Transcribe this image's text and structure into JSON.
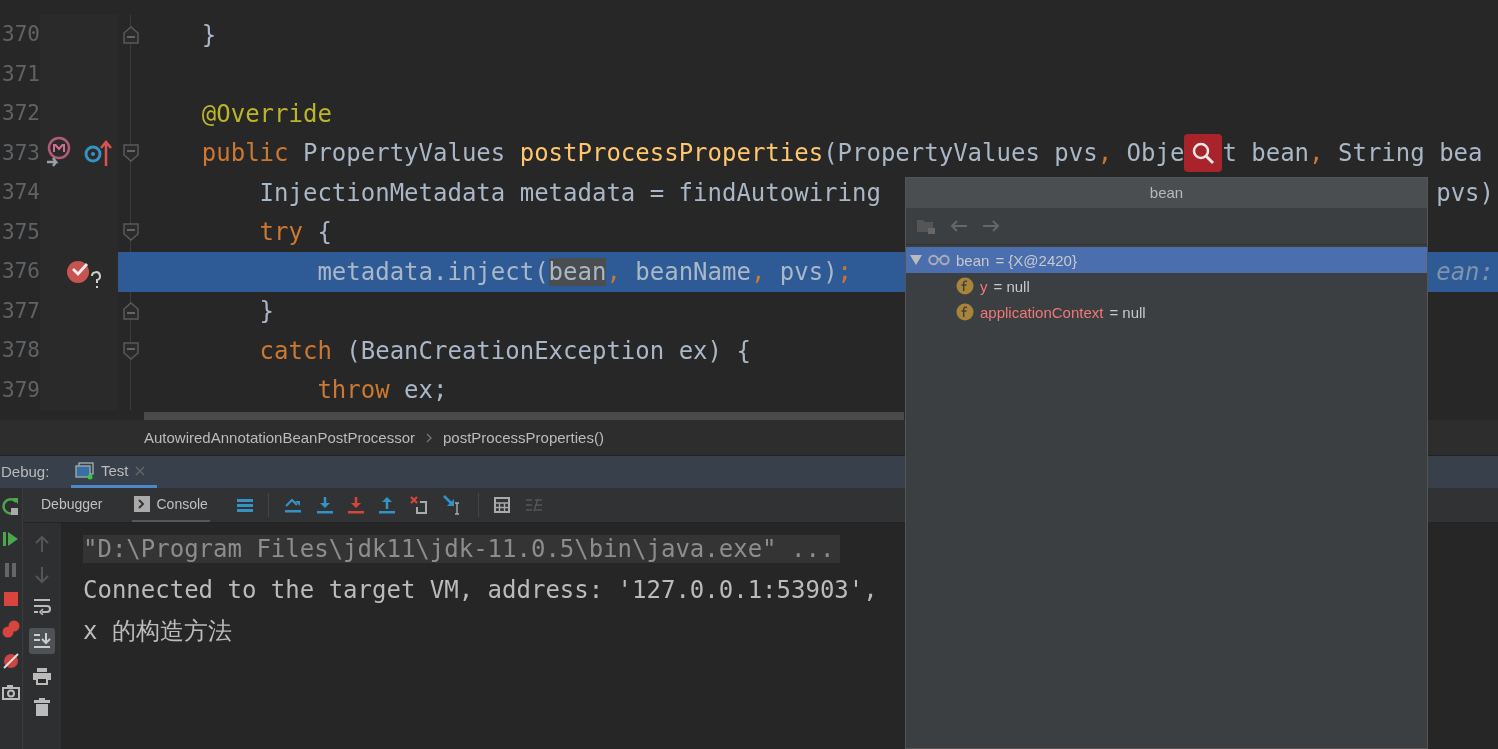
{
  "editor": {
    "lines": [
      {
        "number": "370",
        "fold": {
          "kind": "end"
        },
        "current": false,
        "tokens": [
          {
            "text": "    }",
            "kind": "plain"
          }
        ]
      },
      {
        "number": "371",
        "current": false
      },
      {
        "number": "372",
        "current": false,
        "tokens": [
          {
            "text": "    @Override",
            "kind": "annotation"
          }
        ]
      },
      {
        "number": "373",
        "gutter_icon": {
          "kind": "override"
        },
        "fold": {
          "kind": "start"
        },
        "current": false,
        "tokens": [
          {
            "text": "    public",
            "kind": "keyword"
          },
          {
            "text": " PropertyValues ",
            "kind": "plain"
          },
          {
            "text": "postProcessProperties",
            "kind": "method"
          },
          {
            "text": "(PropertyValues pvs",
            "kind": "plain"
          },
          {
            "text": ",",
            "kind": "keyword"
          },
          {
            "text": " Obje",
            "kind": "plain"
          },
          {
            "kind": "lens"
          },
          {
            "text": "t bean",
            "kind": "plain"
          },
          {
            "text": ",",
            "kind": "keyword"
          },
          {
            "text": " String bea",
            "kind": "plain"
          }
        ]
      },
      {
        "number": "374",
        "current": false,
        "tokens": [
          {
            "text": "        InjectionMetadata metadata = findAutowiring",
            "kind": "plain"
          }
        ],
        "right_tokens": [
          {
            "text": "pvs)",
            "kind": "plain"
          }
        ]
      },
      {
        "number": "375",
        "fold": {
          "kind": "start"
        },
        "current": false,
        "tokens": [
          {
            "text": "        try",
            "kind": "keyword"
          },
          {
            "text": " {",
            "kind": "plain"
          }
        ]
      },
      {
        "number": "376",
        "gutter_icon": {
          "kind": "breakpoint"
        },
        "current": true,
        "tokens": [
          {
            "text": "            metadata.inject(",
            "kind": "plain"
          },
          {
            "text": "bean",
            "kind": "ref"
          },
          {
            "text": ",",
            "kind": "keyword"
          },
          {
            "text": " beanName",
            "kind": "plain"
          },
          {
            "text": ",",
            "kind": "keyword"
          },
          {
            "text": " pvs)",
            "kind": "plain"
          },
          {
            "text": ";",
            "kind": "keyword"
          }
        ],
        "right_tokens": [
          {
            "text": "ean:",
            "kind": "hint"
          }
        ]
      },
      {
        "number": "377",
        "fold": {
          "kind": "end"
        },
        "current": false,
        "tokens": [
          {
            "text": "        }",
            "kind": "plain"
          }
        ]
      },
      {
        "number": "378",
        "fold": {
          "kind": "start"
        },
        "current": false,
        "tokens": [
          {
            "text": "        catch",
            "kind": "keyword"
          },
          {
            "text": " (BeanCreationException ex) {",
            "kind": "plain"
          }
        ]
      },
      {
        "number": "379",
        "current": false,
        "tokens": [
          {
            "text": "            throw",
            "kind": "keyword"
          },
          {
            "text": " ex;",
            "kind": "plain"
          }
        ]
      }
    ]
  },
  "breadcrumb": [
    "AutowiredAnnotationBeanPostProcessor",
    "postProcessProperties()"
  ],
  "debug": {
    "label": "Debug:",
    "tabs": [
      {
        "label": "Test",
        "selected": true
      }
    ],
    "subtabs": [
      {
        "label": "Debugger",
        "selected": false
      },
      {
        "label": "Console",
        "selected": true
      }
    ]
  },
  "console": {
    "lines": [
      {
        "text": "\"D:\\Program Files\\jdk11\\jdk-11.0.5\\bin\\java.exe\" ...",
        "kind": "command"
      },
      {
        "text": "Connected to the target VM, address: '127.0.0.1:53903',",
        "kind": "output"
      },
      {
        "text": "x 的构造方法",
        "kind": "output"
      }
    ]
  },
  "popup": {
    "title": "bean",
    "tree": [
      {
        "name": "bean",
        "value": "= {X@2420}",
        "kind": "object",
        "selected": true,
        "expanded": true,
        "children": [
          {
            "name": "y",
            "value": "= null",
            "kind": "field",
            "selected": false
          },
          {
            "name": "applicationContext",
            "value": "= null",
            "kind": "field",
            "selected": false
          }
        ]
      }
    ]
  }
}
